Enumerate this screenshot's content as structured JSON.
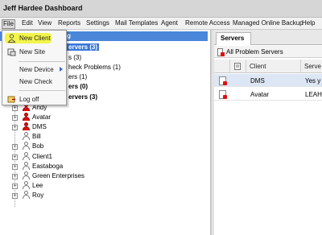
{
  "window": {
    "title": "Jeff Hardee Dashboard"
  },
  "menubar": [
    "File",
    "Edit",
    "View",
    "Reports",
    "Settings",
    "Mail Templates",
    "Agent",
    "Remote Access",
    "Managed Online Backup",
    "Help"
  ],
  "file_menu": {
    "items": [
      {
        "label": "New Client",
        "icon": "person-icon",
        "highlighted": true
      },
      {
        "label": "New Site",
        "icon": "site-icon"
      },
      {
        "label": "New Device",
        "has_submenu": true
      },
      {
        "label": "New Check"
      },
      {
        "label": "Log off",
        "icon": "logoff-icon"
      }
    ]
  },
  "tree": {
    "partial_rows": [
      {
        "text": "g",
        "style": "header"
      },
      {
        "text": "ervers (3)",
        "style": "bold-selected"
      },
      {
        "text": "s (3)",
        "style": "normal"
      },
      {
        "text": "heck Problems (1)",
        "style": "normal"
      },
      {
        "text": "ers (1)",
        "style": "normal"
      },
      {
        "text": "ers (0)",
        "style": "bold"
      },
      {
        "text": "ervers (3)",
        "style": "bold"
      }
    ],
    "clients": [
      {
        "name": "Andy",
        "alert": true
      },
      {
        "name": "Avatar",
        "alert": true
      },
      {
        "name": "DMS",
        "alert": true
      },
      {
        "name": "Bill",
        "alert": false
      },
      {
        "name": "Bob",
        "alert": false
      },
      {
        "name": "Client1",
        "alert": false
      },
      {
        "name": "Eastaboga",
        "alert": false
      },
      {
        "name": "Green Enterprises",
        "alert": false
      },
      {
        "name": "Lee",
        "alert": false
      },
      {
        "name": "Roy",
        "alert": false
      }
    ]
  },
  "right": {
    "tab": "Servers",
    "toolbar_label": "All Problem Servers",
    "columns": [
      "Client",
      "Serve"
    ],
    "rows": [
      {
        "client": "DMS",
        "server": "Yes y",
        "selected": true
      },
      {
        "client": "Avatar",
        "server": "LEAH-",
        "selected": false
      }
    ]
  },
  "colors": {
    "highlight": "#f2f54a",
    "selection": "#3a78d8",
    "alert": "#dd1111"
  }
}
